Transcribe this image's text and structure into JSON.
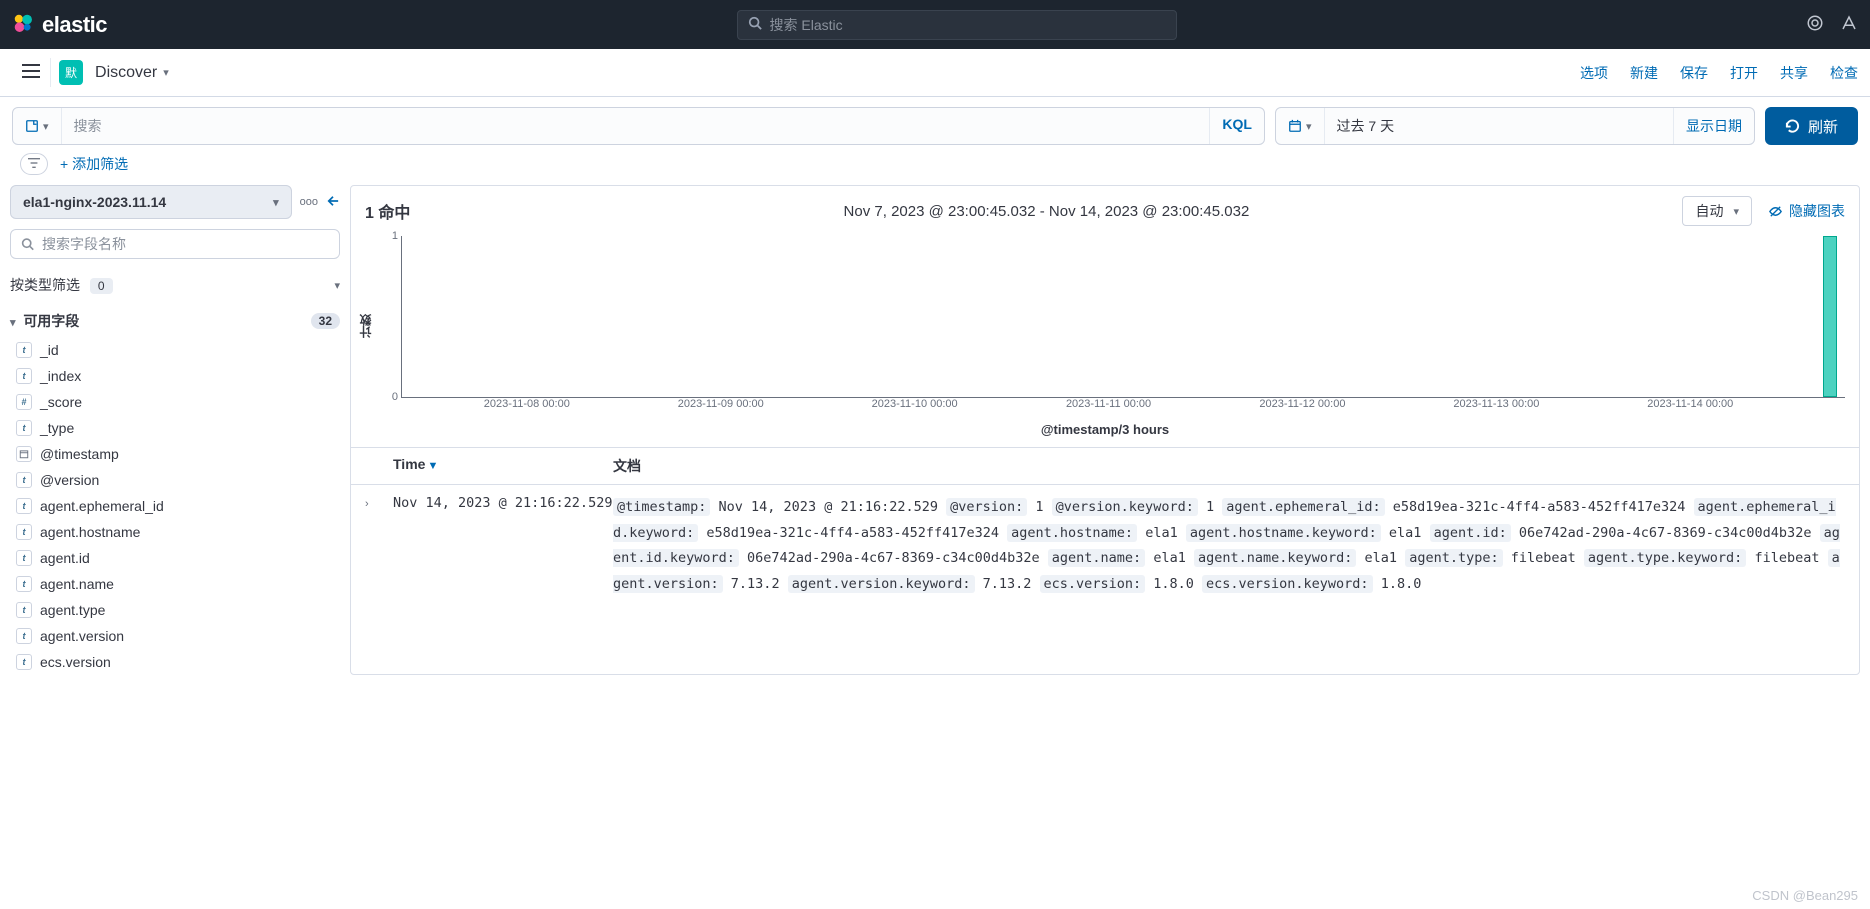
{
  "brand": "elastic",
  "global_search_placeholder": "搜索 Elastic",
  "space_badge": "默",
  "app_name": "Discover",
  "menu": {
    "options": "选项",
    "new": "新建",
    "save": "保存",
    "open": "打开",
    "share": "共享",
    "inspect": "检查"
  },
  "query": {
    "search_placeholder": "搜索",
    "lang": "KQL",
    "timerange_value": "过去 7 天",
    "show_dates": "显示日期",
    "refresh": "刷新"
  },
  "filterbar": {
    "add_filter": "+ 添加筛选"
  },
  "sidebar": {
    "index_pattern": "ela1-nginx-2023.11.14",
    "field_search_placeholder": "搜索字段名称",
    "type_filter_label": "按类型筛选",
    "type_filter_count": "0",
    "available_label": "可用字段",
    "available_count": "32",
    "fields": [
      {
        "type": "t",
        "name": "_id"
      },
      {
        "type": "t",
        "name": "_index"
      },
      {
        "type": "#",
        "name": "_score"
      },
      {
        "type": "t",
        "name": "_type"
      },
      {
        "type": "d",
        "name": "@timestamp"
      },
      {
        "type": "t",
        "name": "@version"
      },
      {
        "type": "t",
        "name": "agent.ephemeral_id"
      },
      {
        "type": "t",
        "name": "agent.hostname"
      },
      {
        "type": "t",
        "name": "agent.id"
      },
      {
        "type": "t",
        "name": "agent.name"
      },
      {
        "type": "t",
        "name": "agent.type"
      },
      {
        "type": "t",
        "name": "agent.version"
      },
      {
        "type": "t",
        "name": "ecs.version"
      }
    ]
  },
  "results": {
    "hit_label": "命中",
    "hit_count": "1",
    "timerange_display": "Nov 7, 2023 @ 23:00:45.032 - Nov 14, 2023 @ 23:00:45.032",
    "interval": "自动",
    "hide_chart": "隐藏图表",
    "columns": {
      "time": "Time",
      "doc": "文档"
    },
    "row_time": "Nov 14, 2023 @ 21:16:22.529",
    "doc_pairs": [
      {
        "k": "@timestamp:",
        "v": "Nov 14, 2023 @ 21:16:22.529"
      },
      {
        "k": "@version:",
        "v": "1"
      },
      {
        "k": "@version.keyword:",
        "v": "1"
      },
      {
        "k": "agent.ephemeral_id:",
        "v": "e58d19ea-321c-4ff4-a583-452ff417e324"
      },
      {
        "k": "agent.ephemeral_id.keyword:",
        "v": "e58d19ea-321c-4ff4-a583-452ff417e324"
      },
      {
        "k": "agent.hostname:",
        "v": "ela1"
      },
      {
        "k": "agent.hostname.keyword:",
        "v": "ela1"
      },
      {
        "k": "agent.id:",
        "v": "06e742ad-290a-4c67-8369-c34c00d4b32e"
      },
      {
        "k": "agent.id.keyword:",
        "v": "06e742ad-290a-4c67-8369-c34c00d4b32e"
      },
      {
        "k": "agent.name:",
        "v": "ela1"
      },
      {
        "k": "agent.name.keyword:",
        "v": "ela1"
      },
      {
        "k": "agent.type:",
        "v": "filebeat"
      },
      {
        "k": "agent.type.keyword:",
        "v": "filebeat"
      },
      {
        "k": "agent.version:",
        "v": "7.13.2"
      },
      {
        "k": "agent.version.keyword:",
        "v": "7.13.2"
      },
      {
        "k": "ecs.version:",
        "v": "1.8.0"
      },
      {
        "k": "ecs.version.keyword:",
        "v": "1.8.0"
      }
    ]
  },
  "chart_data": {
    "type": "bar",
    "title": "",
    "xlabel": "@timestamp/3 hours",
    "ylabel": "计数",
    "ylim": [
      0,
      1
    ],
    "yticks": [
      0,
      1
    ],
    "xticks": [
      "2023-11-08 00:00",
      "2023-11-09 00:00",
      "2023-11-10 00:00",
      "2023-11-11 00:00",
      "2023-11-12 00:00",
      "2023-11-13 00:00",
      "2023-11-14 00:00"
    ],
    "bars": [
      {
        "x_percent": 98.5,
        "value": 1
      }
    ]
  },
  "watermark": "CSDN @Bean295"
}
